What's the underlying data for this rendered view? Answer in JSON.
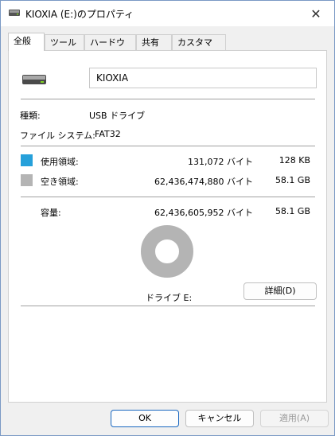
{
  "window": {
    "title": "KIOXIA (E:)のプロパティ"
  },
  "tabs": [
    {
      "label": "全般"
    },
    {
      "label": "ツール"
    },
    {
      "label": "ハードウェア"
    },
    {
      "label": "共有"
    },
    {
      "label": "カスタマイズ"
    }
  ],
  "general": {
    "name_value": "KIOXIA",
    "type_label": "種類:",
    "type_value": "USB ドライブ",
    "fs_label": "ファイル システム:",
    "fs_value": "FAT32",
    "used_label": "使用領域:",
    "used_bytes": "131,072 バイト",
    "used_size": "128 KB",
    "free_label": "空き領域:",
    "free_bytes": "62,436,474,880 バイト",
    "free_size": "58.1 GB",
    "capacity_label": "容量:",
    "capacity_bytes": "62,436,605,952 バイト",
    "capacity_size": "58.1 GB",
    "drive_label": "ドライブ E:",
    "details_button": "詳細(D)",
    "used_fraction": 2.1e-06
  },
  "colors": {
    "used": "#26a0da",
    "free": "#b4b4b4"
  },
  "footer": {
    "ok": "OK",
    "cancel": "キャンセル",
    "apply": "適用(A)"
  }
}
